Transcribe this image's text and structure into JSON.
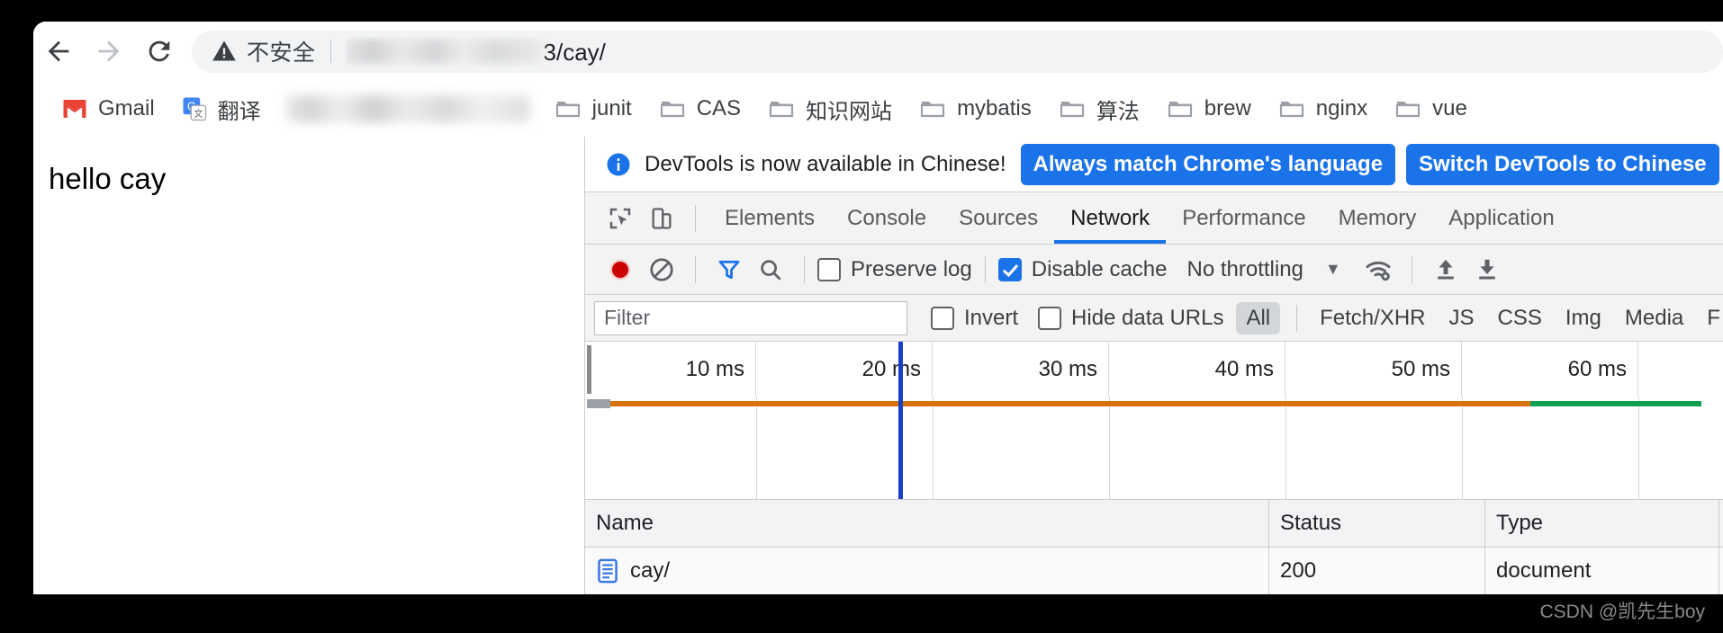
{
  "browser": {
    "nav": {
      "back": "back-arrow",
      "forward": "forward-arrow",
      "reload": "reload"
    },
    "omnibox": {
      "security_label": "不安全",
      "url_suffix": "3/cay/"
    },
    "bookmarks": [
      {
        "label": "Gmail",
        "icon": "gmail-icon"
      },
      {
        "label": "翻译",
        "icon": "google-translate-icon"
      },
      {
        "label": "junit",
        "icon": "folder-icon"
      },
      {
        "label": "CAS",
        "icon": "folder-icon"
      },
      {
        "label": "知识网站",
        "icon": "folder-icon"
      },
      {
        "label": "mybatis",
        "icon": "folder-icon"
      },
      {
        "label": "算法",
        "icon": "folder-icon"
      },
      {
        "label": "brew",
        "icon": "folder-icon"
      },
      {
        "label": "nginx",
        "icon": "folder-icon"
      },
      {
        "label": "vue",
        "icon": "folder-icon"
      }
    ]
  },
  "page": {
    "content_text": "hello cay"
  },
  "devtools": {
    "banner": {
      "message": "DevTools is now available in Chinese!",
      "primary_button": "Always match Chrome's language",
      "secondary_button": "Switch DevTools to Chinese"
    },
    "tabs": [
      {
        "label": "Elements",
        "active": false
      },
      {
        "label": "Console",
        "active": false
      },
      {
        "label": "Sources",
        "active": false
      },
      {
        "label": "Network",
        "active": true
      },
      {
        "label": "Performance",
        "active": false
      },
      {
        "label": "Memory",
        "active": false
      },
      {
        "label": "Application",
        "active": false
      }
    ],
    "network_toolbar": {
      "record_icon": "record-icon",
      "clear_icon": "clear-icon",
      "filter_icon": "filter-icon",
      "search_icon": "search-icon",
      "preserve_log_label": "Preserve log",
      "preserve_log_checked": false,
      "disable_cache_label": "Disable cache",
      "disable_cache_checked": true,
      "throttling_value": "No throttling",
      "wifi_settings_icon": "wifi-settings-icon",
      "import_icon": "upload-arrow-icon",
      "export_icon": "download-arrow-icon"
    },
    "filter_row": {
      "filter_placeholder": "Filter",
      "filter_value": "",
      "invert_label": "Invert",
      "invert_checked": false,
      "hide_data_urls_label": "Hide data URLs",
      "hide_data_urls_checked": false,
      "types": [
        "All",
        "Fetch/XHR",
        "JS",
        "CSS",
        "Img",
        "Media",
        "F"
      ],
      "selected_type": "All"
    },
    "overview": {
      "ticks": [
        "10 ms",
        "20 ms",
        "30 ms",
        "40 ms",
        "50 ms",
        "60 ms"
      ],
      "colors": {
        "orange": "#d8720a",
        "green": "#12a150",
        "playhead": "#1a3fc4"
      }
    },
    "requests_table": {
      "columns": [
        "Name",
        "Status",
        "Type"
      ],
      "rows": [
        {
          "name": "cay/",
          "status": "200",
          "type": "document",
          "icon": "document-icon"
        }
      ]
    }
  },
  "watermark": "CSDN @凯先生boy"
}
